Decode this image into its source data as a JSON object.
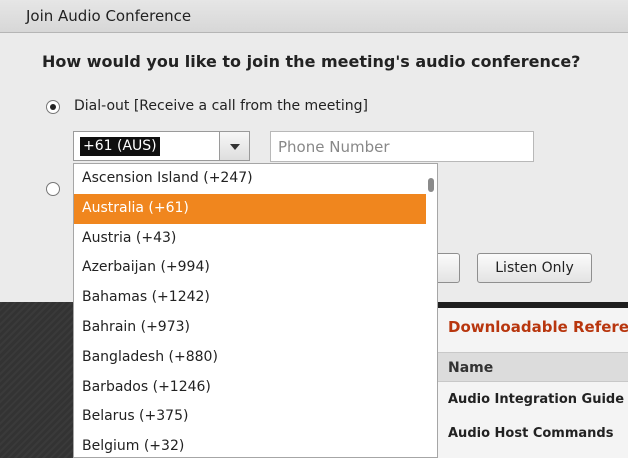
{
  "dialog": {
    "title": "Join Audio Conference",
    "question": "How would you like to join the meeting's audio conference?",
    "dial_out_label": "Dial-out [Receive a call from the meeting]",
    "country_code_value": "+61 (AUS)",
    "phone_placeholder": "Phone Number",
    "listen_only_label": "Listen Only"
  },
  "country_dropdown": {
    "items": [
      "Ascension Island (+247)",
      "Australia (+61)",
      "Austria (+43)",
      "Azerbaijan (+994)",
      "Bahamas (+1242)",
      "Bahrain (+973)",
      "Bangladesh (+880)",
      "Barbados (+1246)",
      "Belarus (+375)",
      "Belgium (+32)"
    ],
    "selected": "Australia (+61)"
  },
  "background_panel": {
    "title": "Downloadable Refere",
    "column_header": "Name",
    "rows": [
      "Audio Integration Guide",
      "Audio Host Commands"
    ]
  },
  "colors": {
    "highlight": "#f0861e",
    "panel_title": "#b8360e"
  }
}
